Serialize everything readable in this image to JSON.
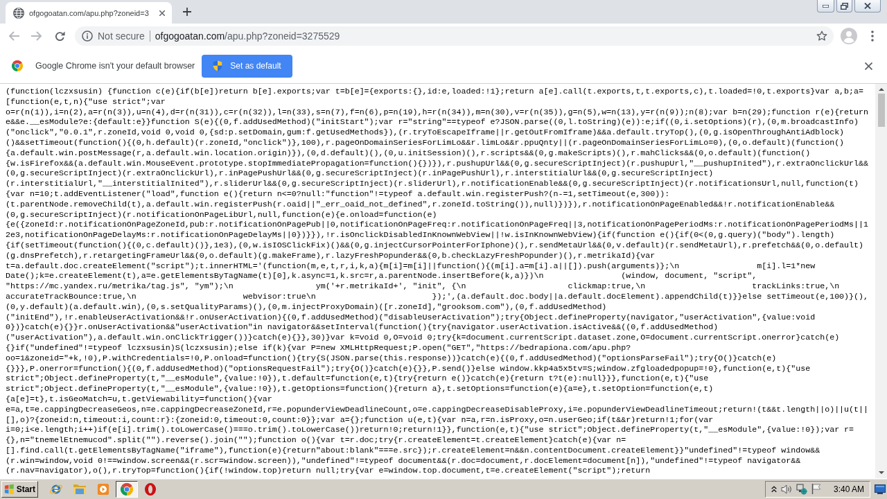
{
  "tab_strip": {
    "tabs": [
      {
        "title": "ofgogoatan.com/apu.php?zoneid=3",
        "selected": true
      }
    ]
  },
  "toolbar": {
    "nav_buttons": [
      {
        "kind": "back",
        "disabled": true
      },
      {
        "kind": "forward",
        "disabled": true
      },
      {
        "kind": "reload",
        "disabled": false
      }
    ],
    "security_label": "Not secure",
    "url_host": "ofgogoatan.com",
    "url_path": "/apu.php?zoneid=3275529"
  },
  "infobar": {
    "message": "Google Chrome isn't your default browser",
    "button_label": "Set as default"
  },
  "page": {
    "code_lines": [
      "(function(lczxsusin) {function c(e){if(b[e])return b[e].exports;var t=b[e]={exports:{},id:e,loaded:!1};return a[e].call(t.exports,t,t.exports,c),t.loaded=!0,t.exports}var a,b;a=",
      "[function(e,t,n){\"use strict\";var",
      "o=r(n(1)),i=n(2),a=r(n(3)),u=n(4),d=r(n(31)),c=r(n(32)),l=n(33),s=n(7),f=n(6),p=n(19),h=r(n(34)),m=n(30),v=r(n(35)),g=n(5),w=n(13),y=r(n(9));n(8);var b=n(29);function r(e){return",
      "e&&e.__esModule?e:{default:e}}function S(e){(0,f.addUsedMethod)(\"initStart\");var r=\"string\"==typeof e?JSON.parse((0,l.toString)(e)):e;if((0,i.setOptions)(r),(0,m.broadcastInfo)",
      "(\"onclick\",\"0.0.1\",r.zoneId,void 0,void 0,{sd:p.setDomain,gum:f.getUsedMethods}),(r.tryToEscapeIframe||r.getOutFromIframe)&&a.default.tryTop(),(0,g.isOpenThroughAntiAdblock)",
      "()&&setTimeout(function(){(0,h.default)(r.zoneId,\"onclick\")},100),r.pageOnDomainSeriesForLimLo&&r.limLo&&r.ppuQnty||(r.pageOnDomainSeriesForLimLo=0),(0,o.default)(function()",
      "{a.default.win.postMessage(r,a.default.win.location.origin)}),(0,d.default)(),(0,u.initSession)(),r.scripts&&(0,g.makeScripts)(),r.mahClicks&&(0,o.default)(function()",
      "{w.isFirefox&&(a.default.win.MouseEvent.prototype.stopImmediatePropagation=function(){})}),r.pushupUrl&&(0,g.secureScriptInject)(r.pushupUrl,\"__pushupInited\"),r.extraOnclickUrl&&",
      "(0,g.secureScriptInject)(r.extraOnclickUrl),r.inPagePushUrl&&(0,g.secureScriptInject)(r.inPagePushUrl),r.interstitialUrl&&(0,g.secureScriptInject)",
      "(r.interstitialUrl,\"__interstitialInited\"),r.sliderUrl&&(0,g.secureScriptInject)(r.sliderUrl),r.notificationEnable&&(0,g.secureScriptInject)(r.notificationsUrl,null,function(t)",
      "{var n=10;t.addEventListener(\"load\",function e(){return n<=0?null:\"function\"!=typeof a.default.win.registerPush?(n-=1,setTimeout(e,300)):",
      "(t.parentNode.removeChild(t),a.default.win.registerPush(r.oaid||\"_err_oaid_not_defined\",r.zoneId.toString()),null)})}),r.notificationOnPageEnabled&&!r.notificationEnable&&",
      "(0,g.secureScriptInject)(r.notificationOnPageLibUrl,null,function(e){e.onload=function(e)",
      "{e({zoneId:r.notificationOnPageZoneId,pub:r.notificationOnPagePub||0,notificationOnPageFreq:r.notificationOnPageFreq||3,notificationOnPagePeriodMs:r.notificationOnPagePeriodMs||1",
      "2e3,notificationOnPageDelayMs:r.notificationOnPageDelayMs||0})}}),!r.isOnclickDisabledInKnownWebView||!w.isInKnownWebView){if(function e(){if(0<(0,g.query)(\"body\").length)",
      "{if(setTimeout(function(){(0,c.default)()},1e3),(0,w.isIOSClickFix)()&&(0,g.injectCursorPointerForIphone)(),r.sendMetaUrl&&(0,v.default)(r.sendMetaUrl),r.prefetch&&(0,o.default)",
      "(g.dnsPrefetch),r.retargetingFrameUrl&&(0,o.default)(g.makeFrame),r.lazyFreshPopunder&&(0,b.checkLazyFreshPopunder)(),r.metrikaId){var",
      "t=a.default.doc.createElement(\"script\");t.innerHTML='(function(m,e,t,r,i,k,a){m[i]=m[i]||function(){(m[i].a=m[i].a||[]).push(arguments)};\\n                m[i].l=1*new",
      "Date();k=e.createElement(t),a=e.getElementsByTagName(t)[0],k.async=1,k.src=r,a.parentNode.insertBefore(k,a)})\\n                (window, document, \"script\",",
      "\"https://mc.yandex.ru/metrika/tag.js\", \"ym\");\\n                 ym('+r.metrikaId+', \"init\", {\\n                     clickmap:true,\\n                      trackLinks:true,\\n",
      "accurateTrackBounce:true,\\n                      webvisor:true\\n                        });',(a.default.doc.body||a.default.docElement).appendChild(t)}}else setTimeout(e,100)}(),",
      "(0,y.default)(a.default.win),(0,s.setQualityParams)(),(0,m.injectProxyDomain)([r.zoneId],\"grooksom.com\"),(0,f.addUsedMethod)",
      "(\"initEnd\"),!r.enableUserActivation&&!r.onUserActivation){(0,f.addUsedMethod)(\"disableUserActivation\");try{Object.defineProperty(navigator,\"userActivation\",{value:void",
      "0})}catch(e){}}r.onUserActivation&&\"userActivation\"in navigator&&setInterval(function(){try{navigator.userActivation.isActive&&((0,f.addUsedMethod)",
      "(\"userActivation\"),a.default.win.onClickTrigger())}catch(e){}},30)}var k=void 0,O=void 0;try{k=document.currentScript.dataset.zone,O=document.currentScript.onerror}catch(e)",
      "{}if(\"undefined\"!=typeof lczxsusin)S(lczxsusin);else if(k){var P=new XMLHttpRequest;P.open(\"GET\",\"https://bedrapiona.com/apu.php?",
      "oo=1&zoneid=\"+k,!0),P.withCredentials=!0,P.onload=function(){try{S(JSON.parse(this.response))}catch(e){(0,f.addUsedMethod)(\"optionsParseFail\");try{O()}catch(e)",
      "{}}},P.onerror=function(){(0,f.addUsedMethod)(\"optionsRequestFail\");try{O()}catch(e){}},P.send()}else window.kkp4a5x5tv=S;window.zfgloadedpopup=!0},function(e,t){\"use",
      "strict\";Object.defineProperty(t,\"__esModule\",{value:!0}),t.default=function(e,t){try{return e()}catch(e){return t?t(e):null}}},function(e,t){\"use",
      "strict\";Object.defineProperty(t,\"__esModule\",{value:!0}),t.getOptions=function(){return a},t.setOptions=function(e){a=e},t.setOption=function(e,t)",
      "{a[e]=t},t.isGeoMatch=u,t.getViewability=function(){var",
      "e=a,t=e.cappingDecreaseGeos,n=e.cappingDecreaseZoneId,r=e.popunderViewDeadlineCount,o=e.cappingDecreaseDisableProxy,i=e.popunderViewDeadlineTimeout;return!(t&&t.length||o)||u(t||",
      "[],o)?{zoneid:n,timeout:i,count:r}:{zoneid:0,timeout:0,count:0}};var a={};function u(e,t){var n=a,r=n.isProxy,o=n.userGeo;if(t&&r)return!1;for(var",
      "i=0;i<e.length;i++)if(e[i].trim().toLowerCase()===o.trim().toLowerCase())return!0;return!1}},function(e,t){\"use strict\";Object.defineProperty(t,\"__esModule\",{value:!0});var r=",
      "{},n=\"tnemelEtnemucod\".split(\"\").reverse().join(\"\");function o(){var t=r.doc;try{r.createElement=t.createElement}catch(e){var n=",
      "[].find.call(t.getElementsByTagName(\"iframe\"),function(e){return\"about:blank\"===e.src});r.createElement=n&&n.contentDocument.createElement}}\"undefined\"!=typeof window&&",
      "(r.win=window,void 0!==window.screen&&(r.scr=window.screen)),\"undefined\"!=typeof document&&(r.doc=document,r.docElement=document[n]),\"undefined\"!=typeof navigator&&",
      "(r.nav=navigator),o(),r.tryTop=function(){if(!window.top)return null;try{var e=window.top.document,t=e.createElement(\"script\");return"
    ]
  },
  "taskbar": {
    "start_label": "Start",
    "apps": [
      {
        "kind": "ie",
        "selected": false
      },
      {
        "kind": "folder",
        "selected": false
      },
      {
        "kind": "media",
        "selected": false
      },
      {
        "kind": "chrome",
        "selected": true
      },
      {
        "kind": "ring",
        "selected": false
      }
    ],
    "clock": "3:40 AM"
  }
}
